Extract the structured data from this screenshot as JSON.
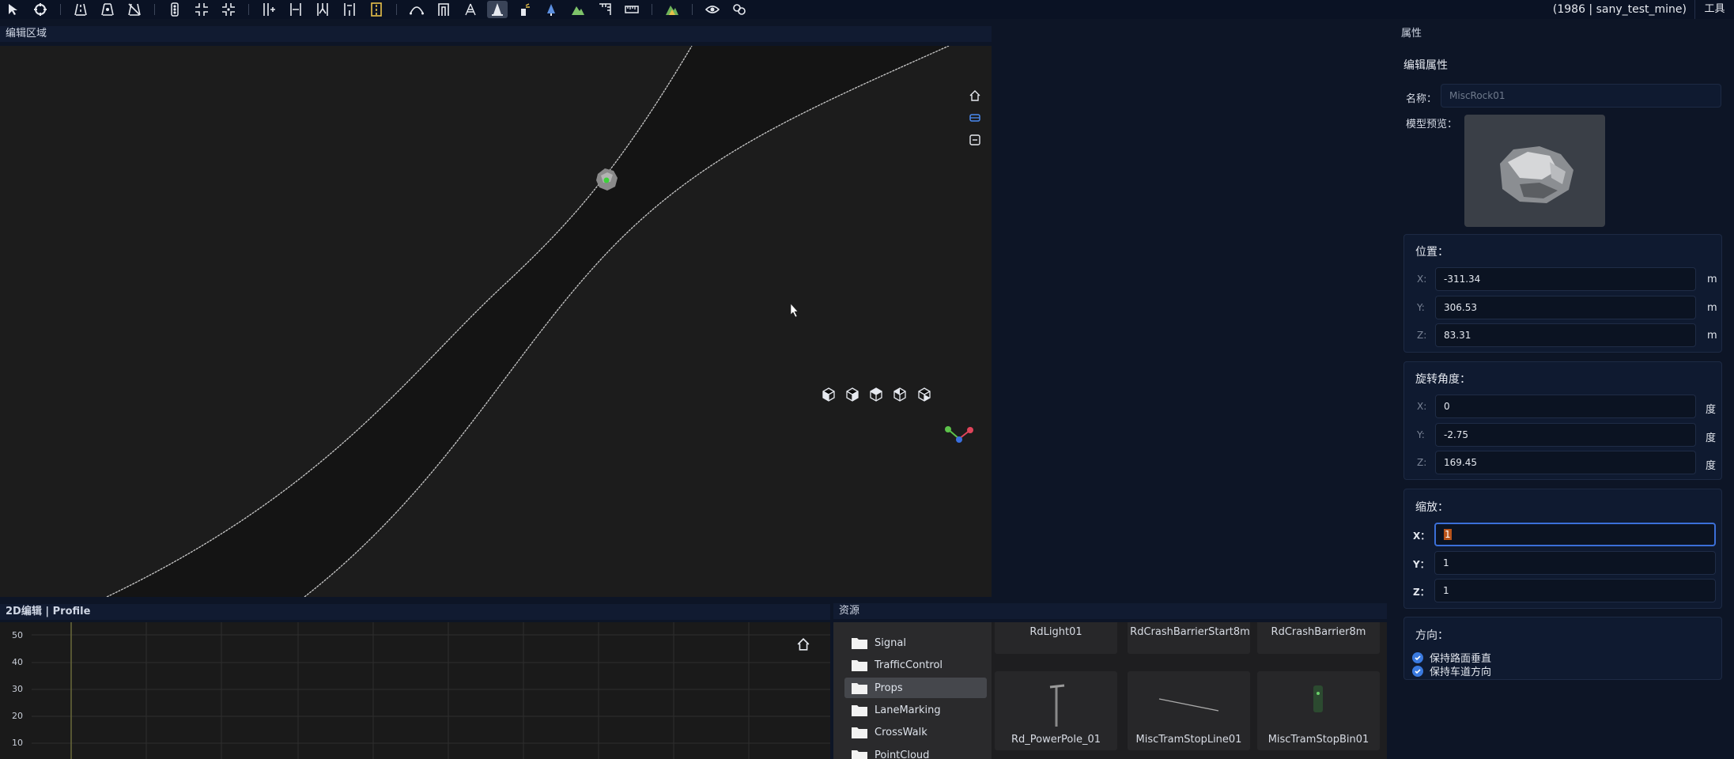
{
  "toolbar": {
    "user_label": "(1986 | sany_test_mine)",
    "tools_menu": "工具",
    "icons": [
      "select-arrow-icon",
      "orbit-icon",
      "road-icon",
      "road-edit-icon",
      "road-delete-icon",
      "traffic-light-icon",
      "junction-icon",
      "junction-edit-icon",
      "lane-add-icon",
      "lane-width-icon",
      "lane-split-icon",
      "lane-merge-icon",
      "lane-marking-icon",
      "curve-icon",
      "arch-icon",
      "crosswalk-icon",
      "cone-icon",
      "spray-icon",
      "sign-icon",
      "terrain-icon",
      "rule-icon",
      "measure-icon",
      "mountain-icon",
      "eye-icon",
      "link-icon"
    ]
  },
  "panels": {
    "edit_area": "编辑区域",
    "profile": "2D编辑 | Profile",
    "resources": "资源",
    "properties": "属性"
  },
  "profile": {
    "y_ticks": [
      "50",
      "40",
      "30",
      "20",
      "10"
    ]
  },
  "resources": {
    "folders": [
      "Signal",
      "TrafficControl",
      "Props",
      "LaneMarking",
      "CrossWalk",
      "PointCloud"
    ],
    "selected": "Props",
    "assets_top": [
      "RdLight01",
      "RdCrashBarrierStart8m",
      "RdCrashBarrier8m"
    ],
    "assets_bottom": [
      "Rd_PowerPole_01",
      "MiscTramStopLine01",
      "MiscTramStopBin01"
    ]
  },
  "properties": {
    "title": "编辑属性",
    "name_label": "名称：",
    "name_value": "MiscRock01",
    "preview_label": "模型预览：",
    "position": {
      "label": "位置：",
      "x": "-311.34",
      "y": "306.53",
      "z": "83.31",
      "unit": "m"
    },
    "rotation": {
      "label": "旋转角度：",
      "x": "0",
      "y": "-2.75",
      "z": "169.45",
      "unit": "度"
    },
    "scale": {
      "label": "缩放：",
      "x": "1",
      "y": "1",
      "z": "1"
    },
    "direction": {
      "label": "方向：",
      "opt1": "保持路面垂直",
      "opt2": "保持车道方向"
    },
    "axis_x": "X:",
    "axis_y": "Y:",
    "axis_z": "Z:",
    "axis_x2": "X：",
    "axis_y2": "Y：",
    "axis_z2": "Z："
  }
}
